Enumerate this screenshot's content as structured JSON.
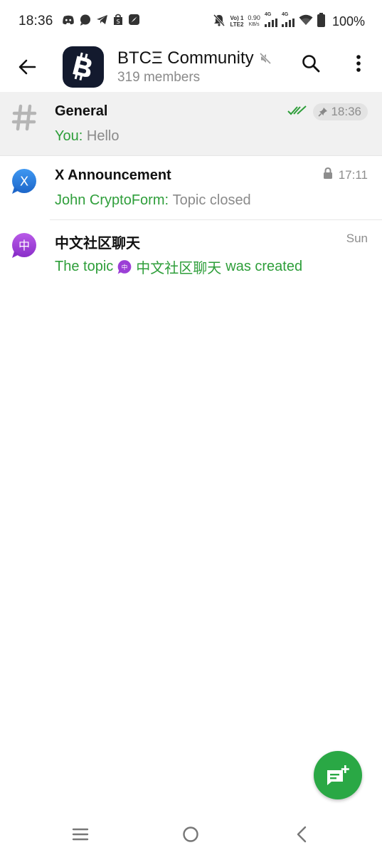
{
  "status_bar": {
    "time": "18:36",
    "left_icons": [
      "discord-icon",
      "chat-bubble-icon",
      "telegram-icon",
      "shopping-bag-icon",
      "compass-icon"
    ],
    "volte_label": "Vo) 1",
    "lte_label": "LTE2",
    "speed_value": "0.90",
    "speed_unit": "KB/s",
    "sig1_label": "4G",
    "sig2_label": "4G",
    "battery": "100%"
  },
  "header": {
    "title": "BTCΞ Community",
    "members": "319 members",
    "icons": [
      "back-arrow-icon",
      "bitcoin-logo",
      "muted-icon",
      "search-icon",
      "more-vertical-icon"
    ]
  },
  "topics": [
    {
      "name": "General",
      "time": "18:36",
      "sender": "You",
      "separator": ": ",
      "text": "Hello",
      "icon": "hashtag-icon",
      "read_status": "double-check-icon",
      "pinned": true
    },
    {
      "name": "X Announcement",
      "time": "17:11",
      "sender": "John CryptoForm",
      "separator": ": ",
      "text": "Topic closed",
      "icon": "topic-bubble-blue-icon",
      "icon_letter": "X",
      "icon_color": "#2a7de1",
      "locked": true
    },
    {
      "name": "中文社区聊天",
      "time": "Sun",
      "preview_prefix": "The topic",
      "preview_topic": "中文社区聊天",
      "preview_suffix": "was created",
      "icon": "topic-bubble-purple-icon",
      "icon_letter": "中",
      "icon_color": "#9b3fd6"
    }
  ],
  "colors": {
    "accent_green": "#2e9e3a",
    "fab_green": "#2aa845",
    "avatar_bg": "#131a2e",
    "selected_row": "#f1f1f1"
  },
  "fab": {
    "icon": "new-topic-icon"
  },
  "nav_bar": {
    "icons": [
      "recent-apps-icon",
      "home-icon",
      "back-icon"
    ]
  }
}
